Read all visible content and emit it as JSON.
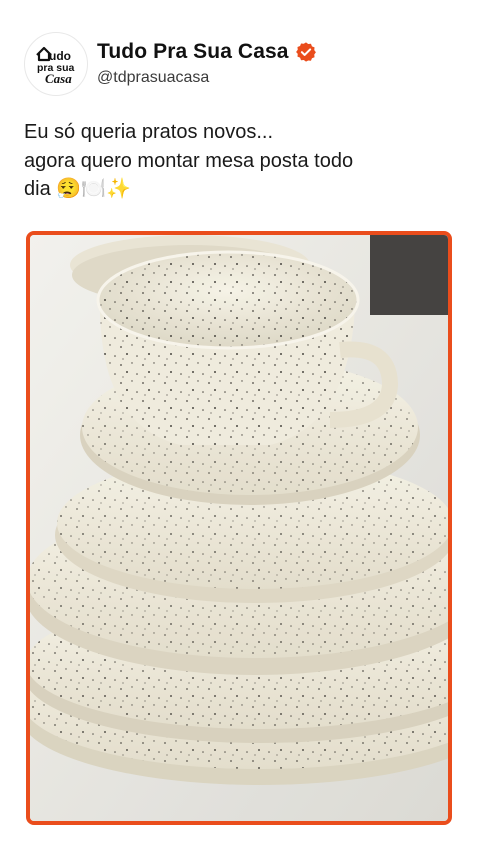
{
  "profile": {
    "display_name": "Tudo Pra Sua Casa",
    "handle": "@tdprasuacasa",
    "verified": true,
    "verified_icon": "verified-badge-icon",
    "avatar_logo_text": [
      "udo",
      "pra sua",
      "Casa"
    ]
  },
  "post": {
    "lines": [
      "Eu só queria pratos novos...",
      "agora quero montar mesa posta todo",
      "dia 😮‍💨🍽️✨"
    ]
  },
  "media": {
    "border_color": "#ea4d1c",
    "subject": "speckled-ceramic-dishes-photo"
  },
  "colors": {
    "brand": "#ea4d1c",
    "text": "#141414",
    "handle": "#3b3b3b"
  }
}
